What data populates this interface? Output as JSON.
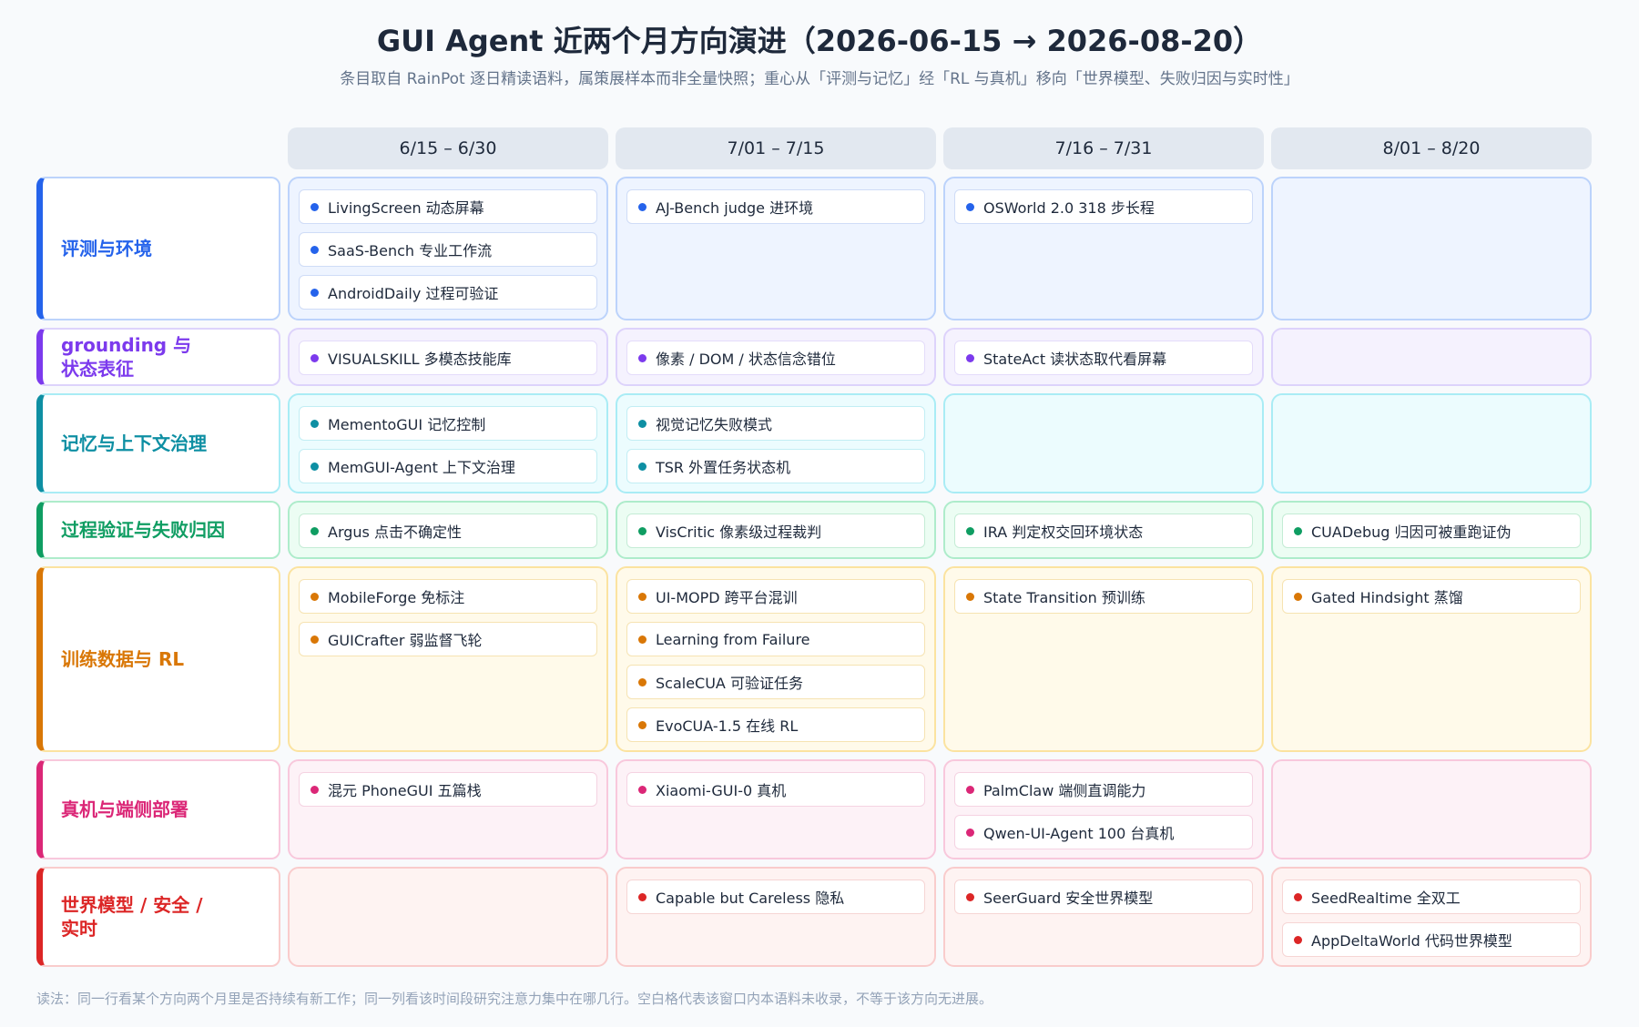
{
  "title": "GUI Agent 近两个月方向演进（2026-06-15 → 2026-08-20）",
  "subtitle": "条目取自 RainPot 逐日精读语料，属策展样本而非全量快照；重心从「评测与记忆」经「RL 与真机」移向「世界模型、失败归因与实时性」",
  "footer": "读法：同一行看某个方向两个月里是否持续有新工作；同一列看该时间段研究注意力集中在哪几行。空白格代表该窗口内本语料未收录，不等于该方向无进展。",
  "periods": [
    "6/15 – 6/30",
    "7/01 – 7/15",
    "7/16 – 7/31",
    "8/01 – 8/20"
  ],
  "rows": [
    {
      "label": "评测与环境",
      "color": "#2563eb",
      "cell_bg": "#eef4ff",
      "cell_border": "#bcd3fb",
      "chip_border": "#cfdcf7",
      "cells": [
        [
          "LivingScreen 动态屏幕",
          "SaaS-Bench 专业工作流",
          "AndroidDaily 过程可验证"
        ],
        [
          "AJ-Bench judge 进环境"
        ],
        [
          "OSWorld 2.0 318 步长程"
        ],
        []
      ]
    },
    {
      "label": "grounding 与\n状态表征",
      "color": "#7c3aed",
      "cell_bg": "#f5f2fe",
      "cell_border": "#ddd3fb",
      "chip_border": "#e4dcfa",
      "cells": [
        [
          "VISUALSKILL 多模态技能库"
        ],
        [
          "像素 / DOM / 状态信念错位"
        ],
        [
          "StateAct 读状态取代看屏幕"
        ],
        []
      ]
    },
    {
      "label": "记忆与上下文治理",
      "color": "#0e8fa3",
      "cell_bg": "#ecfcfe",
      "cell_border": "#a9ecf5",
      "chip_border": "#c2eef4",
      "cells": [
        [
          "MementoGUI 记忆控制",
          "MemGUI-Agent 上下文治理"
        ],
        [
          "视觉记忆失败模式",
          "TSR 外置任务状态机"
        ],
        [],
        []
      ]
    },
    {
      "label": "过程验证与失败归因",
      "color": "#0f9d62",
      "cell_bg": "#ecfdf3",
      "cell_border": "#aeeccb",
      "chip_border": "#c4ecd5",
      "cells": [
        [
          "Argus 点击不确定性"
        ],
        [
          "VisCritic 像素级过程裁判"
        ],
        [
          "IRA 判定权交回环境状态"
        ],
        [
          "CUADebug 归因可被重跑证伪"
        ]
      ]
    },
    {
      "label": "训练数据与 RL",
      "color": "#d97706",
      "cell_bg": "#fffaea",
      "cell_border": "#fbe3a0",
      "chip_border": "#f6e3b2",
      "cells": [
        [
          "MobileForge 免标注",
          "GUICrafter 弱监督飞轮"
        ],
        [
          "UI-MOPD 跨平台混训",
          "Learning from Failure",
          "ScaleCUA 可验证任务",
          "EvoCUA-1.5 在线 RL"
        ],
        [
          "State Transition 预训练"
        ],
        [
          "Gated Hindsight 蒸馏"
        ]
      ]
    },
    {
      "label": "真机与端侧部署",
      "color": "#db2777",
      "cell_bg": "#fdf2f7",
      "cell_border": "#f8c8dc",
      "chip_border": "#f5d3e2",
      "cells": [
        [
          "混元 PhoneGUI 五篇栈"
        ],
        [
          "Xiaomi-GUI-0 真机"
        ],
        [
          "PalmClaw 端侧直调能力",
          "Qwen-UI-Agent 100 台真机"
        ],
        []
      ]
    },
    {
      "label": "世界模型 / 安全 /\n实时",
      "color": "#dc2626",
      "cell_bg": "#fef3f2",
      "cell_border": "#f9cccc",
      "chip_border": "#f6d5d4",
      "cells": [
        [],
        [
          "Capable but Careless 隐私"
        ],
        [
          "SeerGuard 安全世界模型"
        ],
        [
          "SeedRealtime 全双工",
          "AppDeltaWorld 代码世界模型"
        ]
      ]
    }
  ]
}
